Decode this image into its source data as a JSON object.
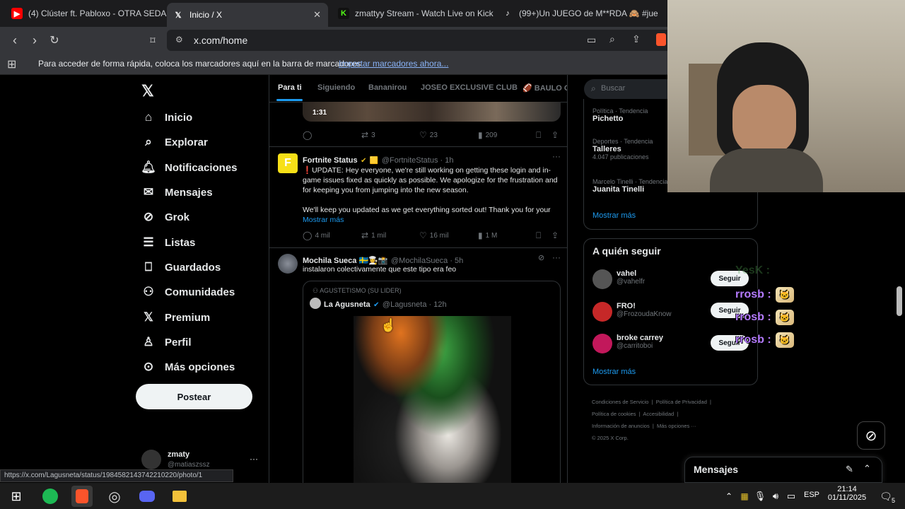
{
  "browser": {
    "tabs": [
      {
        "title": "(4) Clúster ft. Pabloxo - OTRA SEDA (",
        "icon": "youtube-icon",
        "color": "#ff0000"
      },
      {
        "title": "Inicio / X",
        "icon": "x-icon",
        "color": "#ffffff"
      },
      {
        "title": "zmattyy Stream - Watch Live on Kick",
        "icon": "kick-icon",
        "color": "#53fc18"
      },
      {
        "title": "(99+)Un JUEGO de M**RDA 🙈 #jue",
        "icon": "tiktok-icon",
        "color": "#ffffff"
      }
    ],
    "tab_close": "✕",
    "url": "x.com/home",
    "bookmark_bar_text": "Para acceder de forma rápida, coloca los marcadores aquí en la barra de marcadores",
    "bookmark_bar_link": "Importar marcadores ahora...",
    "status_url": "https://x.com/Lagusneta/status/1984582143742210220/photo/1"
  },
  "sidebar": {
    "items": [
      {
        "label": "Inicio",
        "icon": "home-icon"
      },
      {
        "label": "Explorar",
        "icon": "search-icon"
      },
      {
        "label": "Notificaciones",
        "icon": "bell-icon"
      },
      {
        "label": "Mensajes",
        "icon": "mail-icon"
      },
      {
        "label": "Grok",
        "icon": "grok-icon"
      },
      {
        "label": "Listas",
        "icon": "list-icon"
      },
      {
        "label": "Guardados",
        "icon": "bookmark-icon"
      },
      {
        "label": "Comunidades",
        "icon": "communities-icon"
      },
      {
        "label": "Premium",
        "icon": "x-premium-icon"
      },
      {
        "label": "Perfil",
        "icon": "profile-icon"
      },
      {
        "label": "Más opciones",
        "icon": "more-icon"
      }
    ],
    "post_label": "Postear",
    "account_name": "zmaty",
    "account_handle": "@matiaszssz",
    "account_more": "···"
  },
  "feed": {
    "tabs": [
      "Para ti",
      "Siguiendo",
      "Bananirou",
      "JOSEO EXCLUSIVE CLUB",
      "🏈 BAULO CL"
    ],
    "video_duration": "1:31",
    "post1_actions": {
      "reply": "",
      "repost": "3",
      "like": "23",
      "views": "209"
    },
    "post2": {
      "name": "Fortnite Status",
      "handle": "@FortniteStatus · 1h",
      "text1": "❗UPDATE: Hey everyone, we're still working on getting these login and in-game issues fixed as quickly as possible. We apologize for the frustration and for keeping you from jumping into the new season.",
      "text2": "We'll keep you updated as we get everything sorted out! Thank you for your",
      "more": "Mostrar más",
      "actions": {
        "reply": "4 mil",
        "repost": "1 mil",
        "like": "16 mil",
        "views": "1 M"
      }
    },
    "post3": {
      "name": "Mochila Sueca 🇸🇪👩‍🍳📸",
      "handle": "@MochilaSueca · 5h",
      "text": "instalaron colectivamente que este tipo era feo",
      "quote_context": "AGUSTETISMO (SU LIDER)",
      "quote_name": "La Agusneta",
      "quote_handle": "@Lagusneta · 12h"
    }
  },
  "right": {
    "search_placeholder": "Buscar",
    "trends": [
      {
        "cat": "Política · Tendencia",
        "name": "Pichetto",
        "count": ""
      },
      {
        "cat": "Deportes · Tendencia",
        "name": "Talleres",
        "count": "4.047 publicaciones"
      },
      {
        "cat": "Marcelo Tinelli · Tendencia",
        "name": "Juanita Tinelli",
        "count": ""
      }
    ],
    "show_more": "Mostrar más",
    "who_to_follow_title": "A quién seguir",
    "follow": [
      {
        "name": "vahel",
        "handle": "@vahelfr",
        "btn": "Seguir"
      },
      {
        "name": "FRO!",
        "handle": "@FrozoudaKnow",
        "btn": "Seguir"
      },
      {
        "name": "broke carrey",
        "handle": "@carritoboi",
        "btn": "Seguir"
      }
    ],
    "footer": [
      "Condiciones de Servicio",
      "Política de Privacidad",
      "Política de cookies",
      "Accesibilidad",
      "Información de anuncios",
      "Más opciones ···",
      "© 2025 X Corp."
    ],
    "messages_label": "Mensajes"
  },
  "overlay": {
    "chat": [
      {
        "user": "rrosb",
        "sep": ":"
      },
      {
        "user": "rrosb",
        "sep": ":"
      },
      {
        "user": "rrosb",
        "sep": ":"
      }
    ],
    "faded": "YesK :"
  },
  "taskbar": {
    "time": "21:14",
    "date": "01/11/2025",
    "lang": "ESP",
    "notifications": "5"
  }
}
